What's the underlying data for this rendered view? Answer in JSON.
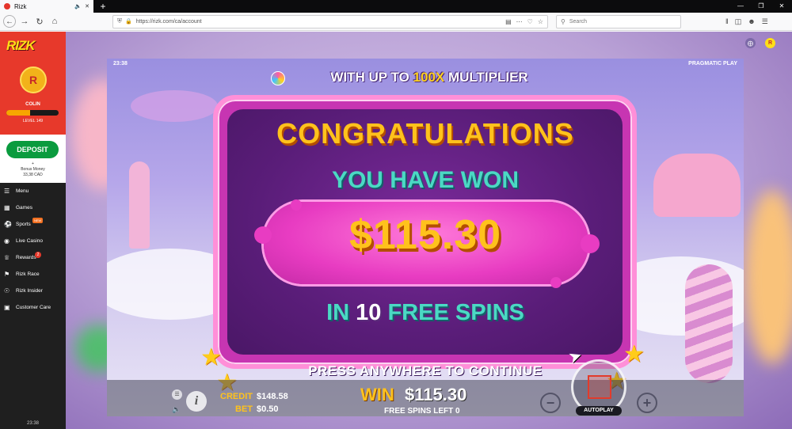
{
  "browser": {
    "tab_title": "Rizk",
    "url": "https://rizk.com/ca/account",
    "search_placeholder": "Search",
    "new_tab": "+"
  },
  "sidebar": {
    "logo": "RIZK",
    "user_name": "COLIN",
    "level_label": "LEVEL 149",
    "level_progress": 0.45,
    "deposit_label": "DEPOSIT",
    "plus": "+",
    "bonus_label": "Bonus Money",
    "bonus_value": "33,38 CAD",
    "menu": [
      {
        "label": "Menu",
        "icon": "hamburger-icon"
      },
      {
        "label": "Games",
        "icon": "games-icon"
      },
      {
        "label": "Sports",
        "icon": "soccer-ball-icon",
        "badge": "NEW"
      },
      {
        "label": "Live Casino",
        "icon": "live-casino-icon"
      },
      {
        "label": "Rewards",
        "icon": "trophy-icon",
        "badge": "2"
      },
      {
        "label": "Rizk Race",
        "icon": "race-icon"
      },
      {
        "label": "Rizk Insider",
        "icon": "globe-icon"
      },
      {
        "label": "Customer Care",
        "icon": "chat-icon"
      }
    ],
    "clock": "23:38"
  },
  "game": {
    "clock": "23:38",
    "provider": "PRAGMATIC PLAY",
    "banner_pre": "WITH UP TO ",
    "banner_hl": "100X",
    "banner_post": " MULTIPLIER",
    "congrats": "CONGRATULATIONS",
    "you_have_won": "YOU HAVE WON",
    "amount": "$115.30",
    "spins_in": "IN ",
    "spins_num": "10",
    "spins_post": " FREE SPINS",
    "press": "PRESS ANYWHERE TO CONTINUE",
    "credit_label": "CREDIT",
    "credit_value": "$148.58",
    "bet_label": "BET",
    "bet_value": "$0.50",
    "win_label": "WIN",
    "win_value": "$115.30",
    "free_spins_left": "FREE SPINS LEFT 0",
    "autoplay": "AUTOPLAY"
  },
  "colors": {
    "brand_red": "#e7392b",
    "deposit_green": "#0a9b3e",
    "gold": "#ffc21c",
    "teal": "#4bd9c4",
    "panel_pink": "#c735b2"
  }
}
